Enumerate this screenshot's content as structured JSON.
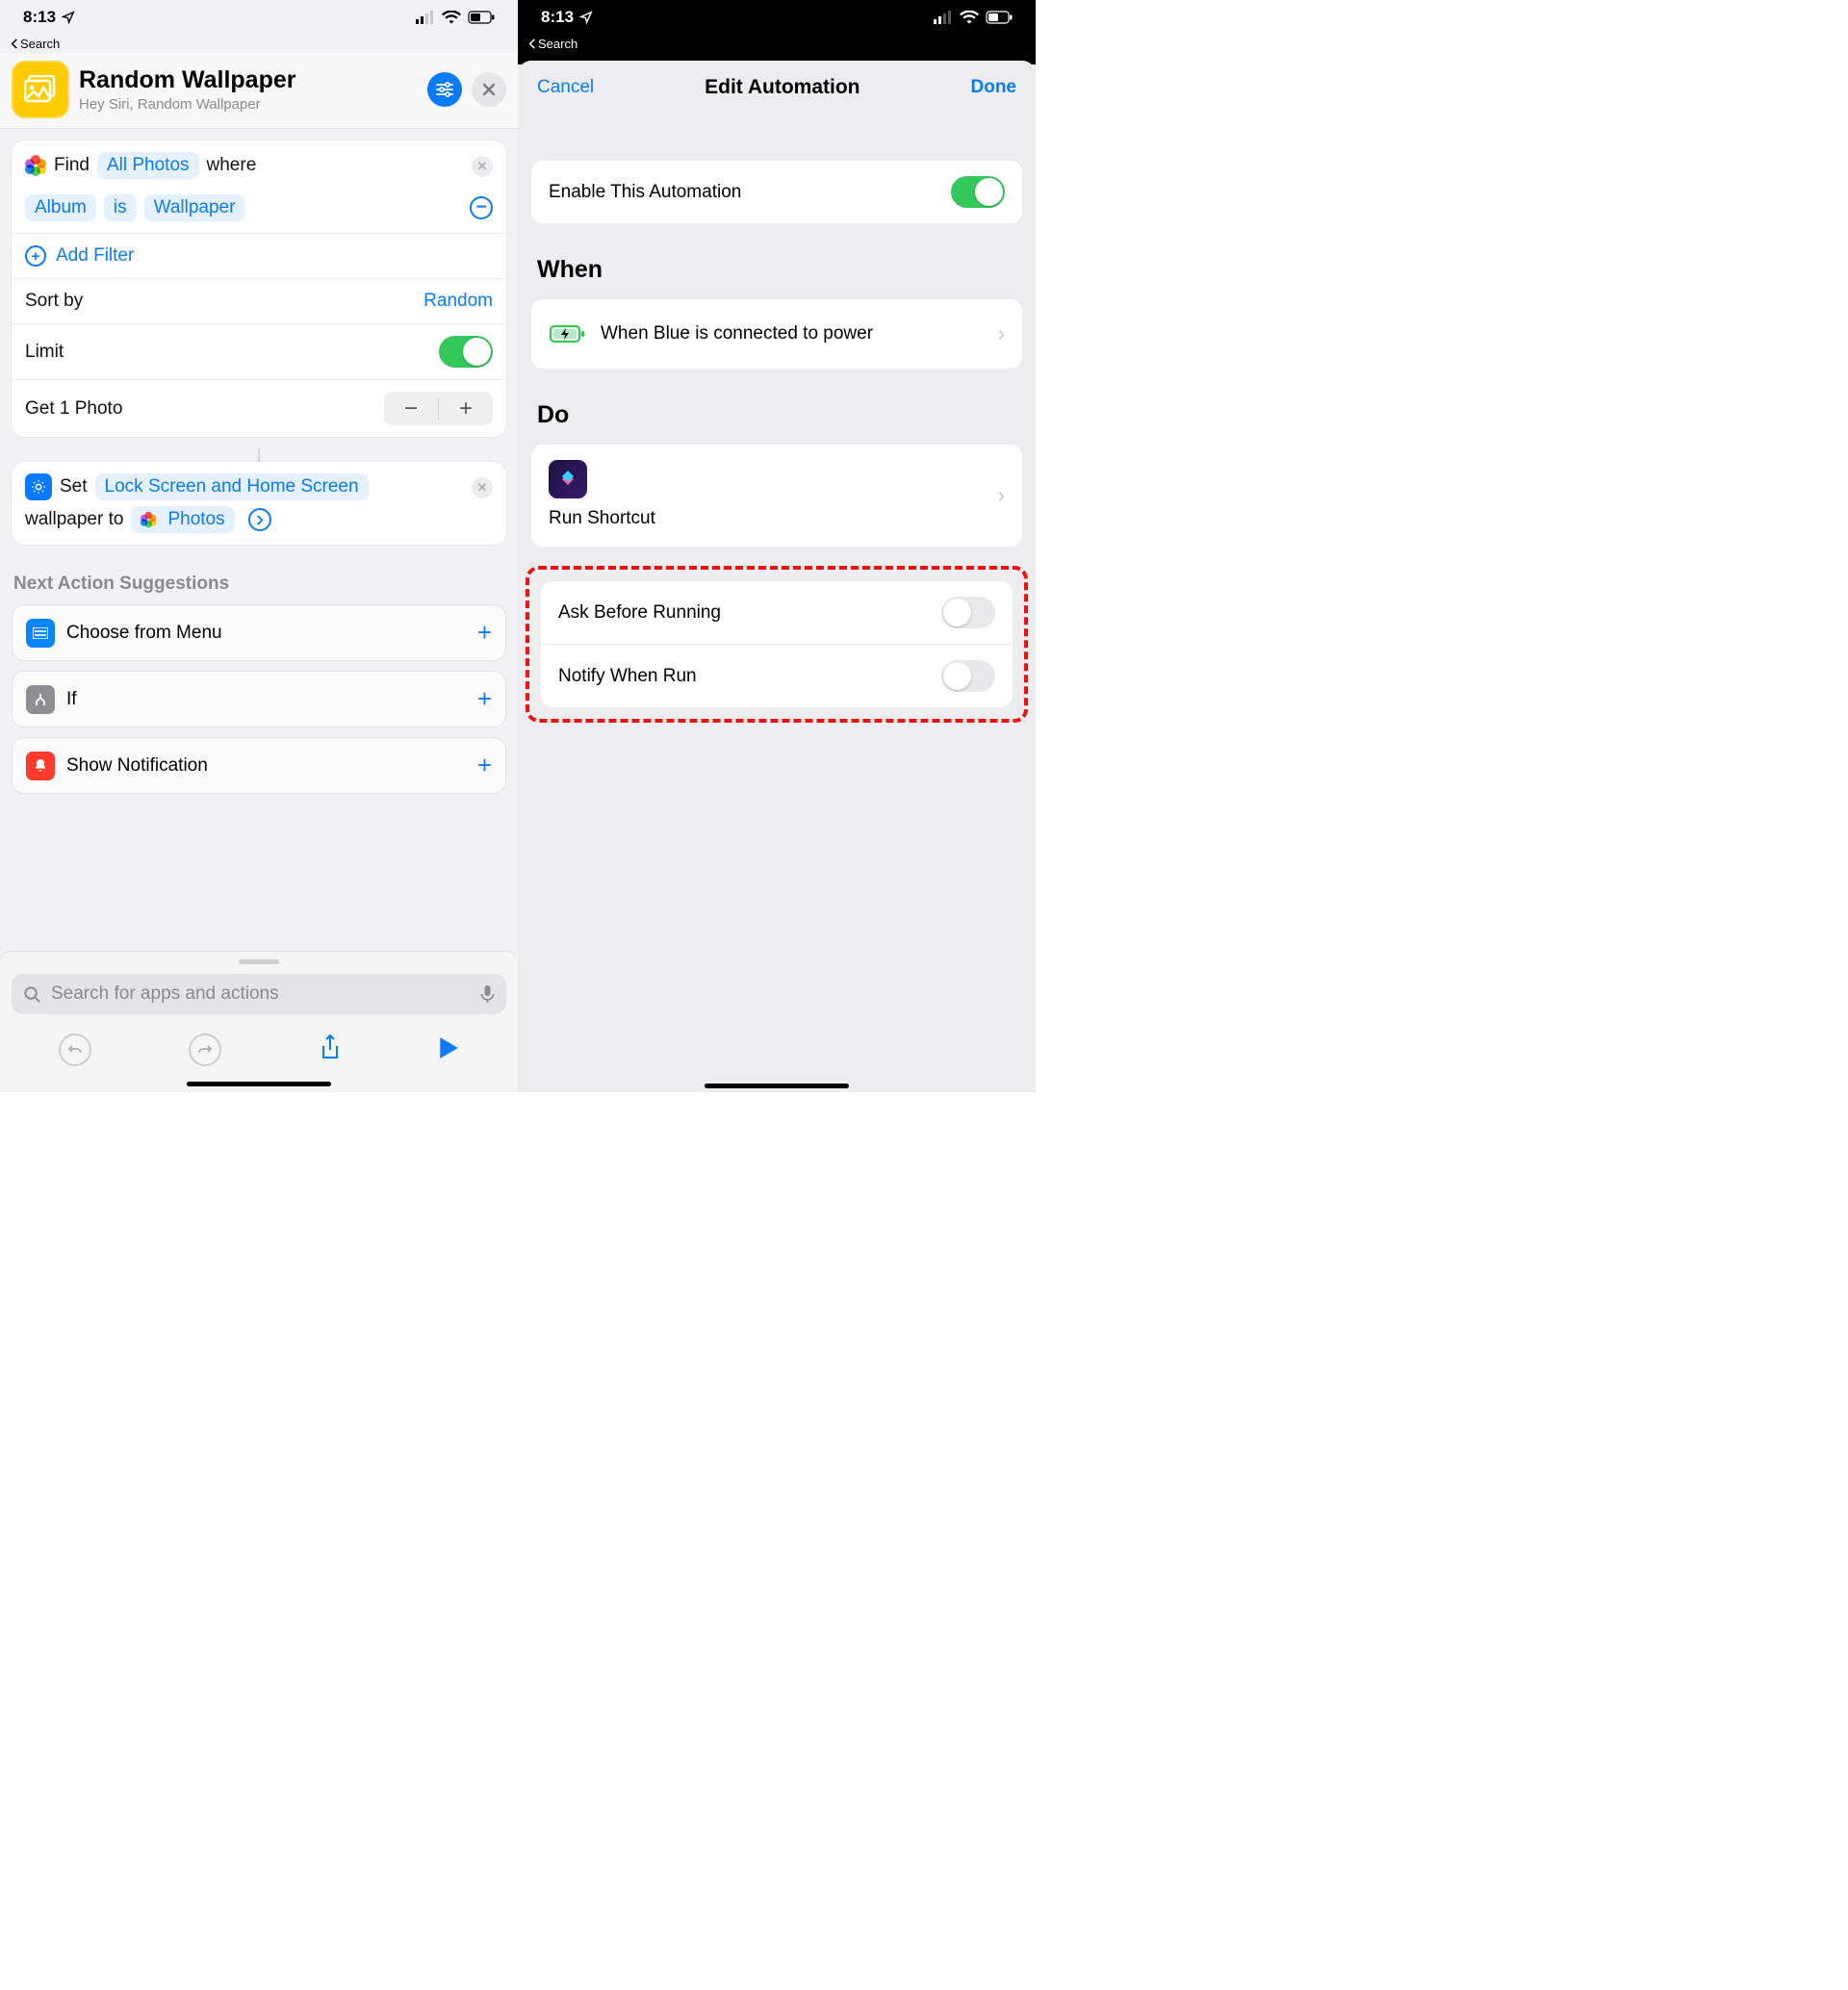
{
  "left": {
    "status": {
      "time": "8:13",
      "back_label": "Search"
    },
    "header": {
      "title": "Random Wallpaper",
      "subtitle": "Hey Siri, Random Wallpaper"
    },
    "action1": {
      "find": "Find",
      "all_photos": "All Photos",
      "where": "where",
      "album": "Album",
      "is": "is",
      "wallpaper": "Wallpaper",
      "add_filter": "Add Filter",
      "sort_by": "Sort by",
      "sort_value": "Random",
      "limit": "Limit",
      "get_label": "Get 1 Photo"
    },
    "action2": {
      "set": "Set",
      "target": "Lock Screen and Home Screen",
      "mid": "wallpaper to",
      "photos": "Photos"
    },
    "suggestions": {
      "title": "Next Action Suggestions",
      "choose": "Choose from Menu",
      "if": "If",
      "notify": "Show Notification"
    },
    "search_placeholder": "Search for apps and actions"
  },
  "right": {
    "status": {
      "time": "8:13",
      "back_label": "Search"
    },
    "nav": {
      "cancel": "Cancel",
      "title": "Edit Automation",
      "done": "Done"
    },
    "enable": "Enable This Automation",
    "when_header": "When",
    "when_text": "When Blue is connected to power",
    "do_header": "Do",
    "do_text": "Run Shortcut",
    "ask": "Ask Before Running",
    "notify": "Notify When Run"
  }
}
